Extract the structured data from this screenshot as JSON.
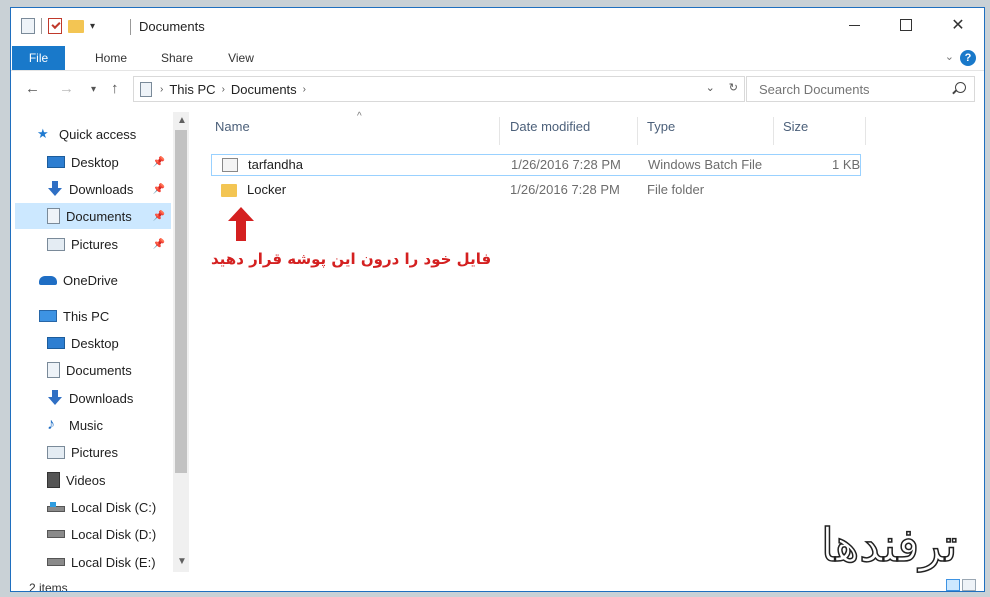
{
  "window": {
    "title": "Documents",
    "controls": {
      "minimize": "minimize",
      "maximize": "maximize",
      "close": "✕"
    }
  },
  "ribbon": {
    "tabs": [
      "File",
      "Home",
      "Share",
      "View"
    ],
    "help": "?"
  },
  "address": {
    "breadcrumbs": [
      "This PC",
      "Documents"
    ],
    "search_placeholder": "Search Documents"
  },
  "nav_pane": {
    "quick_access": "Quick access",
    "quick_items": [
      "Desktop",
      "Downloads",
      "Documents",
      "Pictures"
    ],
    "onedrive": "OneDrive",
    "this_pc": "This PC",
    "pc_items": [
      "Desktop",
      "Documents",
      "Downloads",
      "Music",
      "Pictures",
      "Videos",
      "Local Disk (C:)",
      "Local Disk (D:)",
      "Local Disk (E:)"
    ],
    "selected": "Documents"
  },
  "columns": [
    "Name",
    "Date modified",
    "Type",
    "Size"
  ],
  "files": [
    {
      "name": "tarfandha",
      "date": "1/26/2016 7:28 PM",
      "type": "Windows Batch File",
      "size": "1 KB",
      "icon": "batch-file-icon"
    },
    {
      "name": "Locker",
      "date": "1/26/2016 7:28 PM",
      "type": "File folder",
      "size": "",
      "icon": "folder-icon"
    }
  ],
  "annotation": "فایل خود را درون این پوشه قرار دهید",
  "status": {
    "items": "2 items"
  },
  "watermark": "ترفندها",
  "colors": {
    "accent": "#1979ca",
    "selection": "#cce8ff",
    "annotation": "#d42020",
    "folder": "#f3c553"
  }
}
